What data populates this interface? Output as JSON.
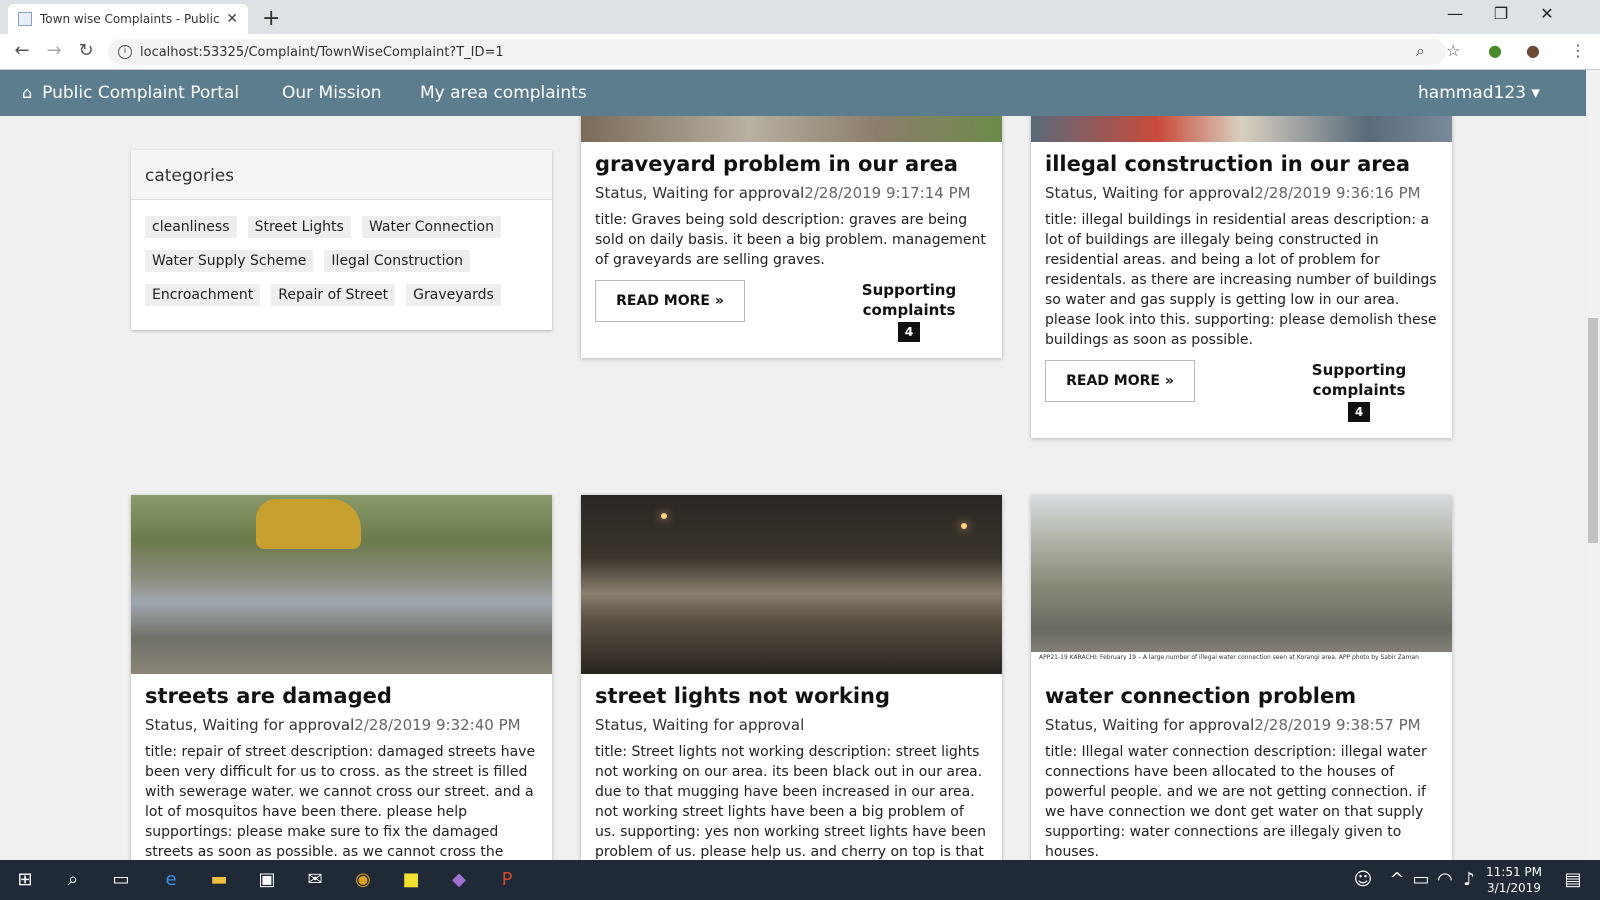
{
  "browser": {
    "tab_title": "Town wise Complaints - Public C",
    "url": "localhost:53325/Complaint/TownWiseComplaint?T_ID=1"
  },
  "navbar": {
    "brand": "Public Complaint Portal",
    "mission": "Our Mission",
    "area": "My area complaints",
    "user": "hammad123 ▾"
  },
  "categories": {
    "title": "categories",
    "items": [
      "cleanliness",
      "Street Lights",
      "Water Connection",
      "Water Supply Scheme",
      "Ilegal Construction",
      "Encroachment",
      "Repair of Street",
      "Graveyards"
    ]
  },
  "cards": [
    {
      "title": "graveyard problem in our area",
      "status": "Status, Waiting for approval",
      "date": "2/28/2019 9:17:14 PM",
      "desc": "title: Graves being sold description: graves are being sold on daily basis. it been a big problem. management of graveyards are selling graves.",
      "read_more": "READ MORE »",
      "support_label": "Supporting complaints",
      "support_count": "4"
    },
    {
      "title": "illegal construction in our area",
      "status": "Status, Waiting for approval",
      "date": "2/28/2019 9:36:16 PM",
      "desc": "title: illegal buildings in residential areas description: a lot of buildings are illegaly being constructed in residential areas. and being a lot of problem for residentals. as there are increasing number of buildings so water and gas supply is getting low in our area. please look into this. supporting: please demolish these buildings as soon as possible.",
      "read_more": "READ MORE »",
      "support_label": "Supporting complaints",
      "support_count": "4"
    },
    {
      "title": "streets are damaged",
      "status": "Status, Waiting for approval",
      "date": "2/28/2019 9:32:40 PM",
      "desc": "title: repair of street description: damaged streets have been very difficult for us to cross. as the street is filled with sewerage water. we cannot cross our street. and a lot of mosquitos have been there. please help supportings: please make sure to fix the damaged streets as soon as possible. as we cannot cross the"
    },
    {
      "title": "street lights not working",
      "status": "Status, Waiting for approval",
      "date": "",
      "desc": "title: Street lights not working description: street lights not working on our area. its been black out in our area. due to that mugging have been increased in our area. not working street lights have been a big problem of us. supporting: yes non working street lights have been problem of us. please help us. and cherry on top is that"
    },
    {
      "title": "water connection problem",
      "status": "Status, Waiting for approval",
      "date": "2/28/2019 9:38:57 PM",
      "desc": "title: Illegal water connection description: illegal water connections have been allocated to the houses of powerful people. and we are not getting connection. if we have connection we dont get water on that supply supporting: water connections are illegaly given to houses.",
      "caption": "APP21-19 KARACHI: February 19 – A large number of illegal water connection seen at Korangi area. APP photo by Sabir Zaman"
    }
  ],
  "taskbar": {
    "time": "11:51 PM",
    "date": "3/1/2019"
  }
}
